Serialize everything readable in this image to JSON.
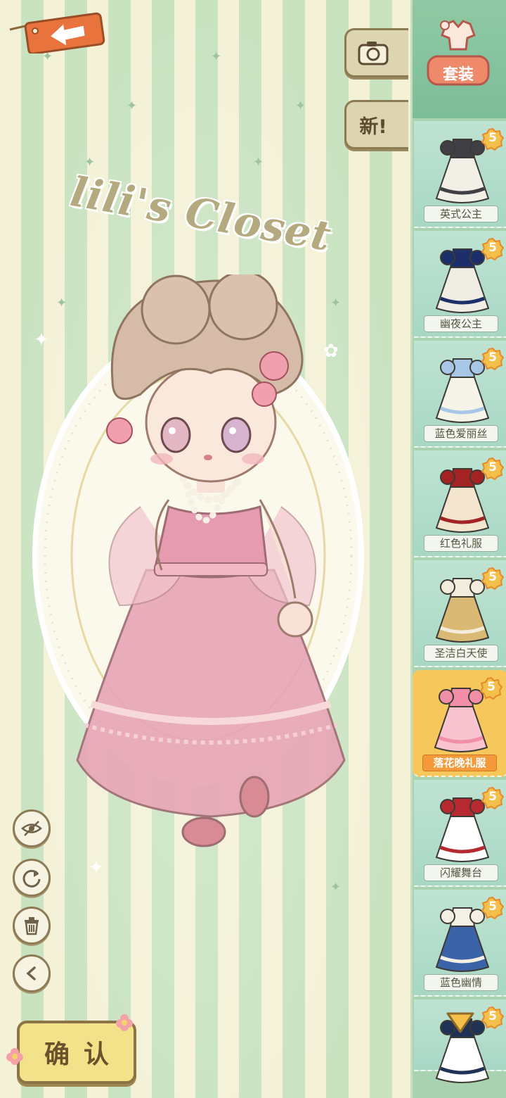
{
  "logo": {
    "text": "lili's Closet"
  },
  "top_buttons": {
    "new_label": "新!"
  },
  "sidebar": {
    "suit_tab_label": "套装",
    "items": [
      {
        "label": "英式公主",
        "cost": "5",
        "selected": false,
        "colors": [
          "#3f3f45",
          "#f2efe6"
        ]
      },
      {
        "label": "幽夜公主",
        "cost": "5",
        "selected": false,
        "colors": [
          "#1d2f6b",
          "#f0ede4"
        ]
      },
      {
        "label": "蓝色爱丽丝",
        "cost": "5",
        "selected": false,
        "colors": [
          "#a8c7e6",
          "#f6f3e8"
        ]
      },
      {
        "label": "红色礼服",
        "cost": "5",
        "selected": false,
        "colors": [
          "#a32222",
          "#f4e5cf"
        ]
      },
      {
        "label": "圣洁白天使",
        "cost": "5",
        "selected": false,
        "colors": [
          "#f3ecdd",
          "#d9b973"
        ]
      },
      {
        "label": "落花晚礼服",
        "cost": "5",
        "selected": true,
        "colors": [
          "#f08fa5",
          "#f9c3cf"
        ]
      },
      {
        "label": "闪耀舞台",
        "cost": "5",
        "selected": false,
        "colors": [
          "#b62a2f",
          "#ffffff"
        ]
      },
      {
        "label": "蓝色幽情",
        "cost": "5",
        "selected": false,
        "colors": [
          "#f4f0e6",
          "#3a63a8"
        ]
      },
      {
        "label": "",
        "cost": "5",
        "selected": false,
        "colors": [
          "#203255",
          "#ffffff"
        ]
      }
    ]
  },
  "confirm": {
    "label": "确认"
  },
  "colors": {
    "accent_orange": "#e9733c",
    "gold": "#f4c04a",
    "stripe_green": "#c9e3c1",
    "stripe_cream": "#f3f1d6"
  },
  "icons": {
    "back": "left-arrow-icon",
    "camera": "camera-icon",
    "hide": "eye-slash-icon",
    "reset": "rotate-icon",
    "delete": "trash-icon",
    "undo": "chevron-left-icon"
  }
}
